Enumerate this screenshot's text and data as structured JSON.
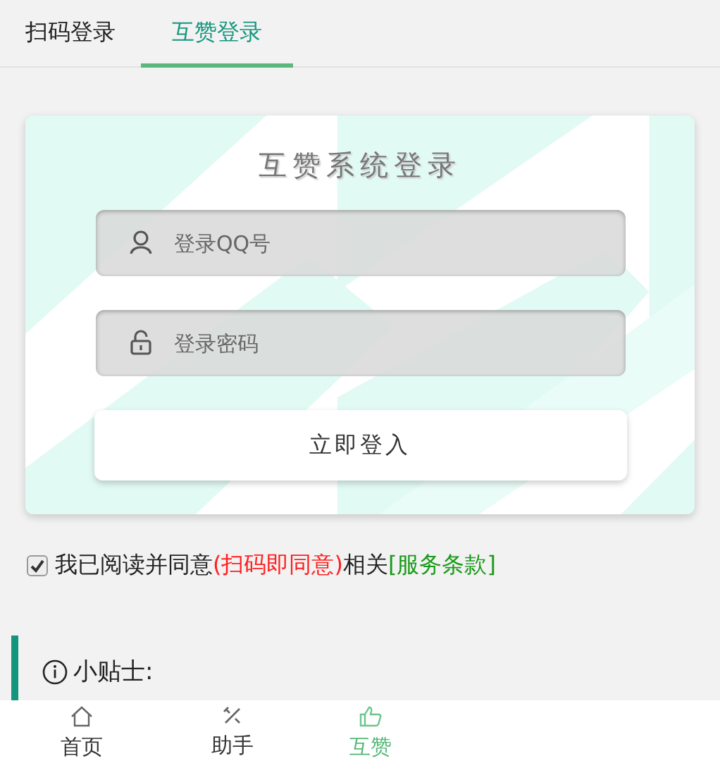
{
  "tabs": [
    {
      "label": "扫码登录",
      "selected": false
    },
    {
      "label": "互赞登录",
      "selected": true
    }
  ],
  "login_card": {
    "title": "互赞系统登录",
    "fields": [
      {
        "kind": "user",
        "placeholder": "登录QQ号"
      },
      {
        "kind": "password",
        "placeholder": "登录密码"
      }
    ],
    "submit": "立即登入"
  },
  "agreement": {
    "checked": true,
    "text": "我已阅读并同意",
    "highlight": "(扫码即同意)",
    "text_after": "相关",
    "link": "[服务条款]"
  },
  "tip": {
    "title": "小贴士:"
  },
  "bottom_nav": [
    {
      "kind": "home",
      "label": "首页",
      "selected": false
    },
    {
      "kind": "tools",
      "label": "助手",
      "selected": false
    },
    {
      "kind": "thumb",
      "label": "互赞",
      "selected": true
    }
  ]
}
